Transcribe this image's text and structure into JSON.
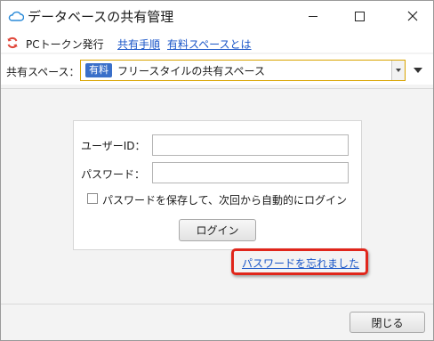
{
  "window": {
    "title": "データベースの共有管理",
    "icon": "cloud-icon"
  },
  "toolbar": {
    "pc_token_label": "PCトークン発行",
    "procedure_link": "共有手順",
    "paid_space_link": "有料スペースとは"
  },
  "space": {
    "label": "共有スペース：",
    "badge": "有料",
    "selected": "フリースタイルの共有スペース"
  },
  "login": {
    "user_id_label": "ユーザーID：",
    "user_id_value": "",
    "password_label": "パスワード：",
    "password_value": "",
    "remember_label": "パスワードを保存して、次回から自動的にログイン",
    "login_button": "ログイン",
    "forgot_link": "パスワードを忘れました"
  },
  "footer": {
    "close_button": "閉じる"
  },
  "colors": {
    "link": "#1a56c8",
    "highlight": "#e0261b",
    "badge": "#3a6fc9",
    "select_border": "#d9a400"
  }
}
